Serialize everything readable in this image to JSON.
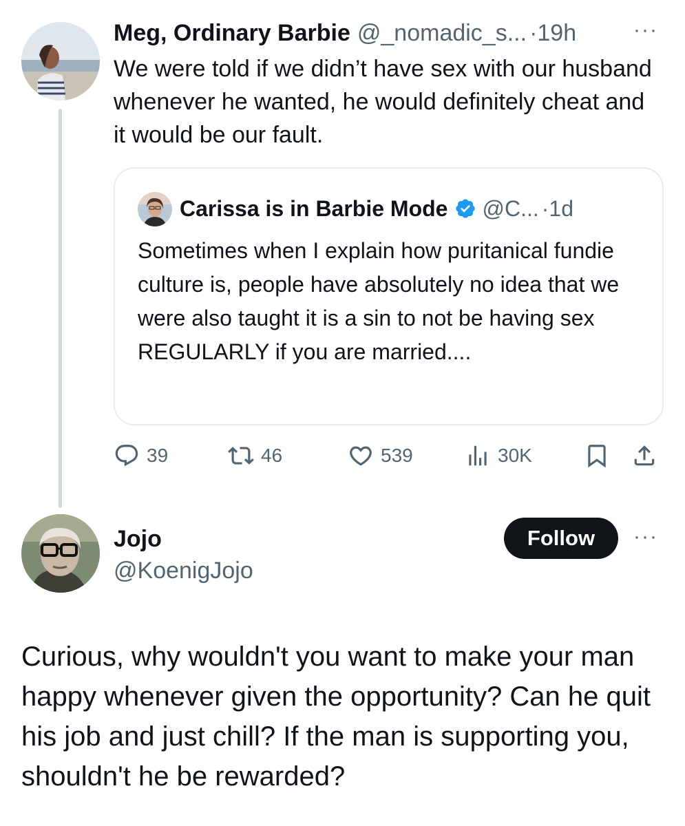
{
  "tweet": {
    "author_name": "Meg, Ordinary Barbie",
    "handle": "@_nomadic_s...",
    "separator": "·",
    "time": "19h",
    "more": "···",
    "text": "We were told if we didn’t have sex with our husband whenever he wanted, he would definitely cheat and it would be our fault.",
    "quote": {
      "author_name": "Carissa is in Barbie Mode",
      "handle": "@C...",
      "separator": "·",
      "time": "1d",
      "text": "Sometimes when I explain how puritanical fundie culture is, people have absolutely no idea that we were also taught it is a sin to not be having sex REGULARLY if you are married...."
    },
    "actions": {
      "replies": "39",
      "retweets": "46",
      "likes": "539",
      "views": "30K"
    }
  },
  "reply": {
    "author_name": "Jojo",
    "handle": "@KoenigJojo",
    "follow_label": "Follow",
    "more": "···",
    "text": "Curious, why wouldn't you want to make your man happy whenever given the opportunity? Can he quit his job and just chill? If the man is supporting you, shouldn't he be rewarded?"
  },
  "colors": {
    "text": "#0f1419",
    "muted": "#536471",
    "border": "#e6ecf0",
    "thread_line": "#cfd9de",
    "verified": "#1d9bf0"
  },
  "icons": [
    "reply-icon",
    "retweet-icon",
    "like-icon",
    "views-icon",
    "bookmark-icon",
    "share-icon",
    "verified-badge-icon",
    "more-icon"
  ]
}
